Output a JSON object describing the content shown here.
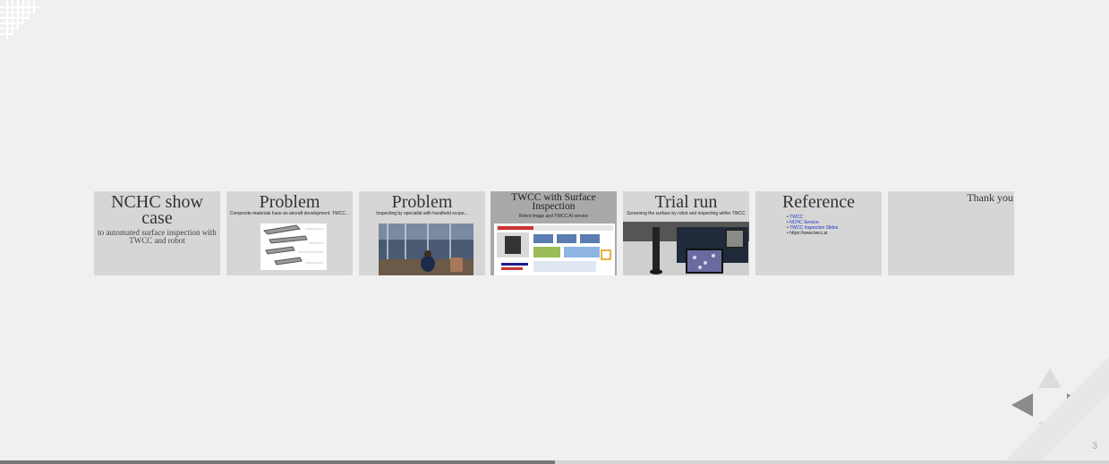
{
  "slides": [
    {
      "title": "NCHC show case",
      "subtitle": "to automated surface inspection with TWCC and robot"
    },
    {
      "title": "Problem",
      "caption": "Composite materials have an aircraft development. TWCC..."
    },
    {
      "title": "Problem",
      "caption": "Inspecting by specialist with handheld scope..."
    },
    {
      "title": "TWCC with Surface Inspection",
      "caption": "Robot image and TWCC AI service",
      "active": true
    },
    {
      "title": "Trial run",
      "caption": "Screening the surface by robot and inspecting within TWCC"
    },
    {
      "title": "Reference",
      "refs": [
        "TWCC",
        "NCHC Service",
        "TWCC Inspection Slides",
        "https://www.twcc.ai"
      ]
    },
    {
      "title": "Thank you"
    }
  ],
  "nav": {
    "prev_icon": "left-arrow-icon",
    "next_icon": "right-arrow-icon",
    "up_icon": "up-arrow-icon",
    "down_icon": "down-arrow-icon"
  },
  "page_number": "3",
  "progress": 0.5,
  "colors": {
    "background": "#f0f0f0",
    "thumb": "#d6d6d6",
    "thumb_active": "#a9a9a9",
    "nav_enabled": "#8b8b8b",
    "nav_disabled": "#dcdcdc"
  }
}
